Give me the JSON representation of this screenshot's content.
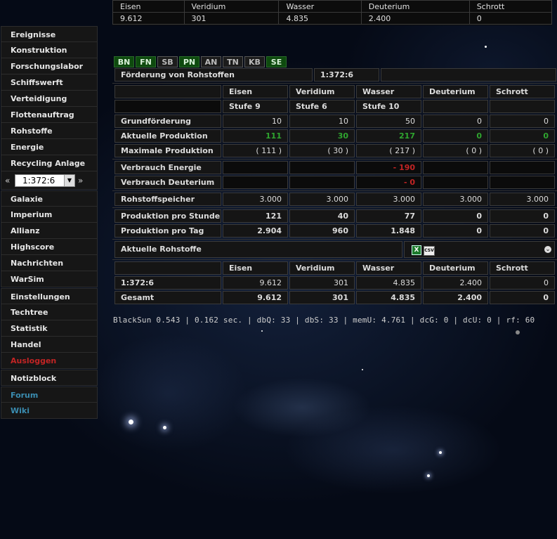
{
  "resources_bar": {
    "headers": [
      "Eisen",
      "Veridium",
      "Wasser",
      "Deuterium",
      "Schrott"
    ],
    "values": [
      "9.612",
      "301",
      "4.835",
      "2.400",
      "0"
    ]
  },
  "menu": {
    "items1": [
      "Ereignisse",
      "Konstruktion",
      "Forschungslabor",
      "Schiffswerft",
      "Verteidigung",
      "Flottenauftrag",
      "Rohstoffe",
      "Energie",
      "Recycling Anlage"
    ],
    "planet": {
      "prev": "«",
      "value": "1:372:6",
      "next": "»"
    },
    "items2": [
      "Galaxie",
      "Imperium",
      "Allianz",
      "Highscore",
      "Nachrichten",
      "WarSim"
    ],
    "items3": [
      "Einstellungen",
      "Techtree",
      "Statistik",
      "Handel"
    ],
    "logout": "Ausloggen",
    "notes": "Notizblock",
    "forum": "Forum",
    "wiki": "Wiki"
  },
  "tabs": [
    {
      "label": "BN",
      "active": true
    },
    {
      "label": "FN",
      "active": true
    },
    {
      "label": "SB",
      "active": false
    },
    {
      "label": "PN",
      "active": true
    },
    {
      "label": "AN",
      "active": false
    },
    {
      "label": "TN",
      "active": false
    },
    {
      "label": "KB",
      "active": false
    },
    {
      "label": "SE",
      "active": true
    }
  ],
  "production": {
    "title": "Förderung von Rohstoffen",
    "coords": "1:372:6",
    "columns": [
      "Eisen",
      "Veridium",
      "Wasser",
      "Deuterium",
      "Schrott"
    ],
    "levels": [
      "Stufe 9",
      "Stufe 6",
      "Stufe 10",
      "",
      ""
    ],
    "rows": [
      {
        "label": "Grundförderung",
        "values": [
          "10",
          "10",
          "50",
          "0",
          "0"
        ]
      },
      {
        "label": "Aktuelle Produktion",
        "values": [
          "111",
          "30",
          "217",
          "0",
          "0"
        ]
      },
      {
        "label": "Maximale Produktion",
        "values": [
          "( 111 )",
          "( 30 )",
          "( 217 )",
          "( 0 )",
          "( 0 )"
        ]
      }
    ],
    "consumption": [
      {
        "label": "Verbrauch Energie",
        "values": [
          "",
          "",
          "- 190",
          "",
          ""
        ]
      },
      {
        "label": "Verbrauch Deuterium",
        "values": [
          "",
          "",
          "- 0",
          "",
          ""
        ]
      }
    ],
    "storage": {
      "label": "Rohstoffspeicher",
      "values": [
        "3.000",
        "3.000",
        "3.000",
        "3.000",
        "3.000"
      ]
    },
    "per_hour": {
      "label": "Produktion pro Stunde",
      "values": [
        "121",
        "40",
        "77",
        "0",
        "0"
      ]
    },
    "per_day": {
      "label": "Produktion pro Tag",
      "values": [
        "2.904",
        "960",
        "1.848",
        "0",
        "0"
      ]
    }
  },
  "current": {
    "title": "Aktuelle Rohstoffe",
    "icons": [
      "excel-export-icon",
      "csv-export-icon",
      "collapse-icon"
    ],
    "columns": [
      "Eisen",
      "Veridium",
      "Wasser",
      "Deuterium",
      "Schrott"
    ],
    "planet_row": {
      "label": "1:372:6",
      "values": [
        "9.612",
        "301",
        "4.835",
        "2.400",
        "0"
      ]
    },
    "total_row": {
      "label": "Gesamt",
      "values": [
        "9.612",
        "301",
        "4.835",
        "2.400",
        "0"
      ]
    }
  },
  "footer": "BlackSun 0.543 | 0.162 sec. | dbQ: 33 | dbS: 33 | memU: 4.761 | dcG: 0 | dcU: 0 | rf: 60",
  "colors": {
    "positive": "#2fa52f",
    "negative": "#c22424",
    "logout": "#b21a1a",
    "link": "#3a8cb0",
    "tab_active": "#0e4a0e"
  }
}
